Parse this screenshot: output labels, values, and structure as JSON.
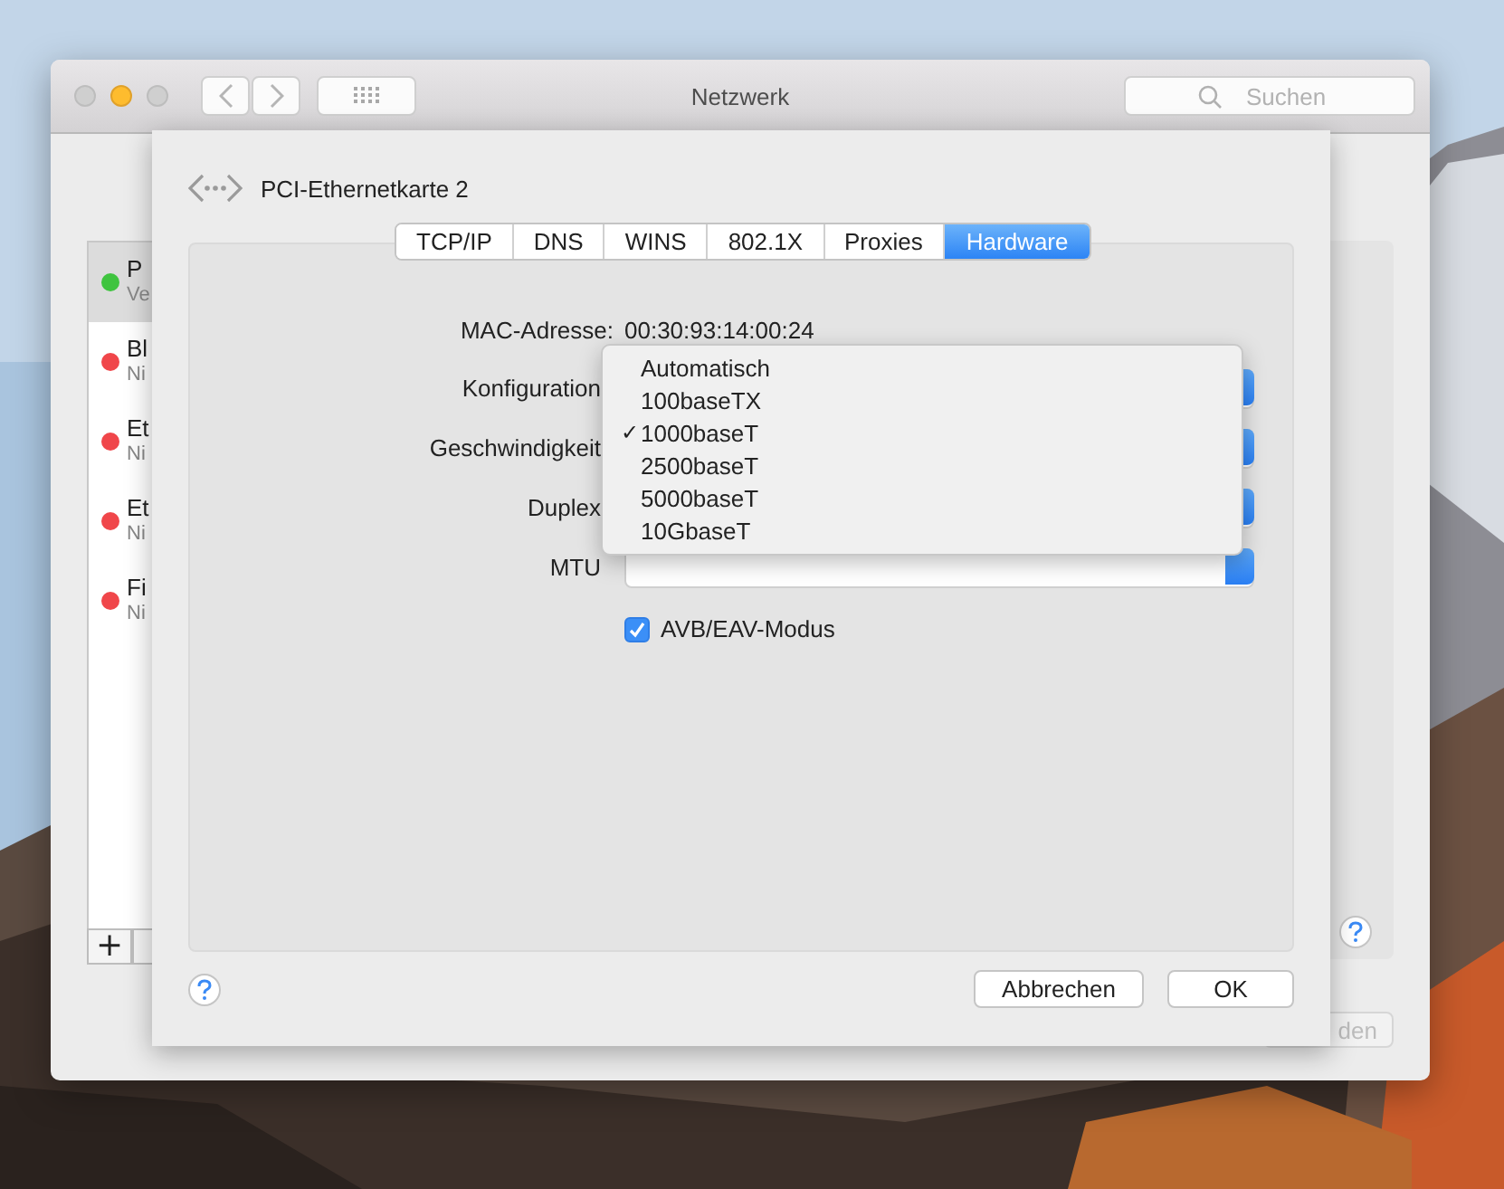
{
  "window": {
    "title": "Netzwerk",
    "search": {
      "placeholder": "Suchen"
    }
  },
  "sidebar": {
    "items": [
      {
        "name": "P",
        "status": "Ve",
        "color": "#3fc43f",
        "selected": true
      },
      {
        "name": "Bl",
        "status": "Ni",
        "color": "#f0464a",
        "selected": false
      },
      {
        "name": "Et",
        "status": "Ni",
        "color": "#f0464a",
        "selected": false
      },
      {
        "name": "Et",
        "status": "Ni",
        "color": "#f0464a",
        "selected": false
      },
      {
        "name": "Fi",
        "status": "Ni",
        "color": "#f0464a",
        "selected": false
      }
    ],
    "add_button": "+"
  },
  "right_button": "den",
  "sheet": {
    "title": "PCI-Ethernetkarte 2",
    "tabs": [
      {
        "label": "TCP/IP",
        "selected": false
      },
      {
        "label": "DNS",
        "selected": false
      },
      {
        "label": "WINS",
        "selected": false
      },
      {
        "label": "802.1X",
        "selected": false
      },
      {
        "label": "Proxies",
        "selected": false
      },
      {
        "label": "Hardware",
        "selected": true
      }
    ],
    "fields": [
      {
        "kind": "text",
        "label": "MAC-Adresse:",
        "value": "00:30:93:14:00:24"
      },
      {
        "kind": "popup",
        "label": "Konfiguration"
      },
      {
        "kind": "popup",
        "label": "Geschwindigkeit"
      },
      {
        "kind": "popup",
        "label": "Duplex"
      },
      {
        "kind": "popup",
        "label": "MTU"
      }
    ],
    "checkbox": {
      "label": "AVB/EAV-Modus",
      "checked": true
    },
    "menu": {
      "items": [
        {
          "label": "Automatisch",
          "checked": false
        },
        {
          "label": "100baseTX",
          "checked": false
        },
        {
          "label": "1000baseT",
          "checked": true
        },
        {
          "label": "2500baseT",
          "checked": false
        },
        {
          "label": "5000baseT",
          "checked": false
        },
        {
          "label": "10GbaseT",
          "checked": false
        }
      ],
      "check_mark": "✓"
    },
    "buttons": [
      "Abbrechen",
      "OK"
    ]
  }
}
